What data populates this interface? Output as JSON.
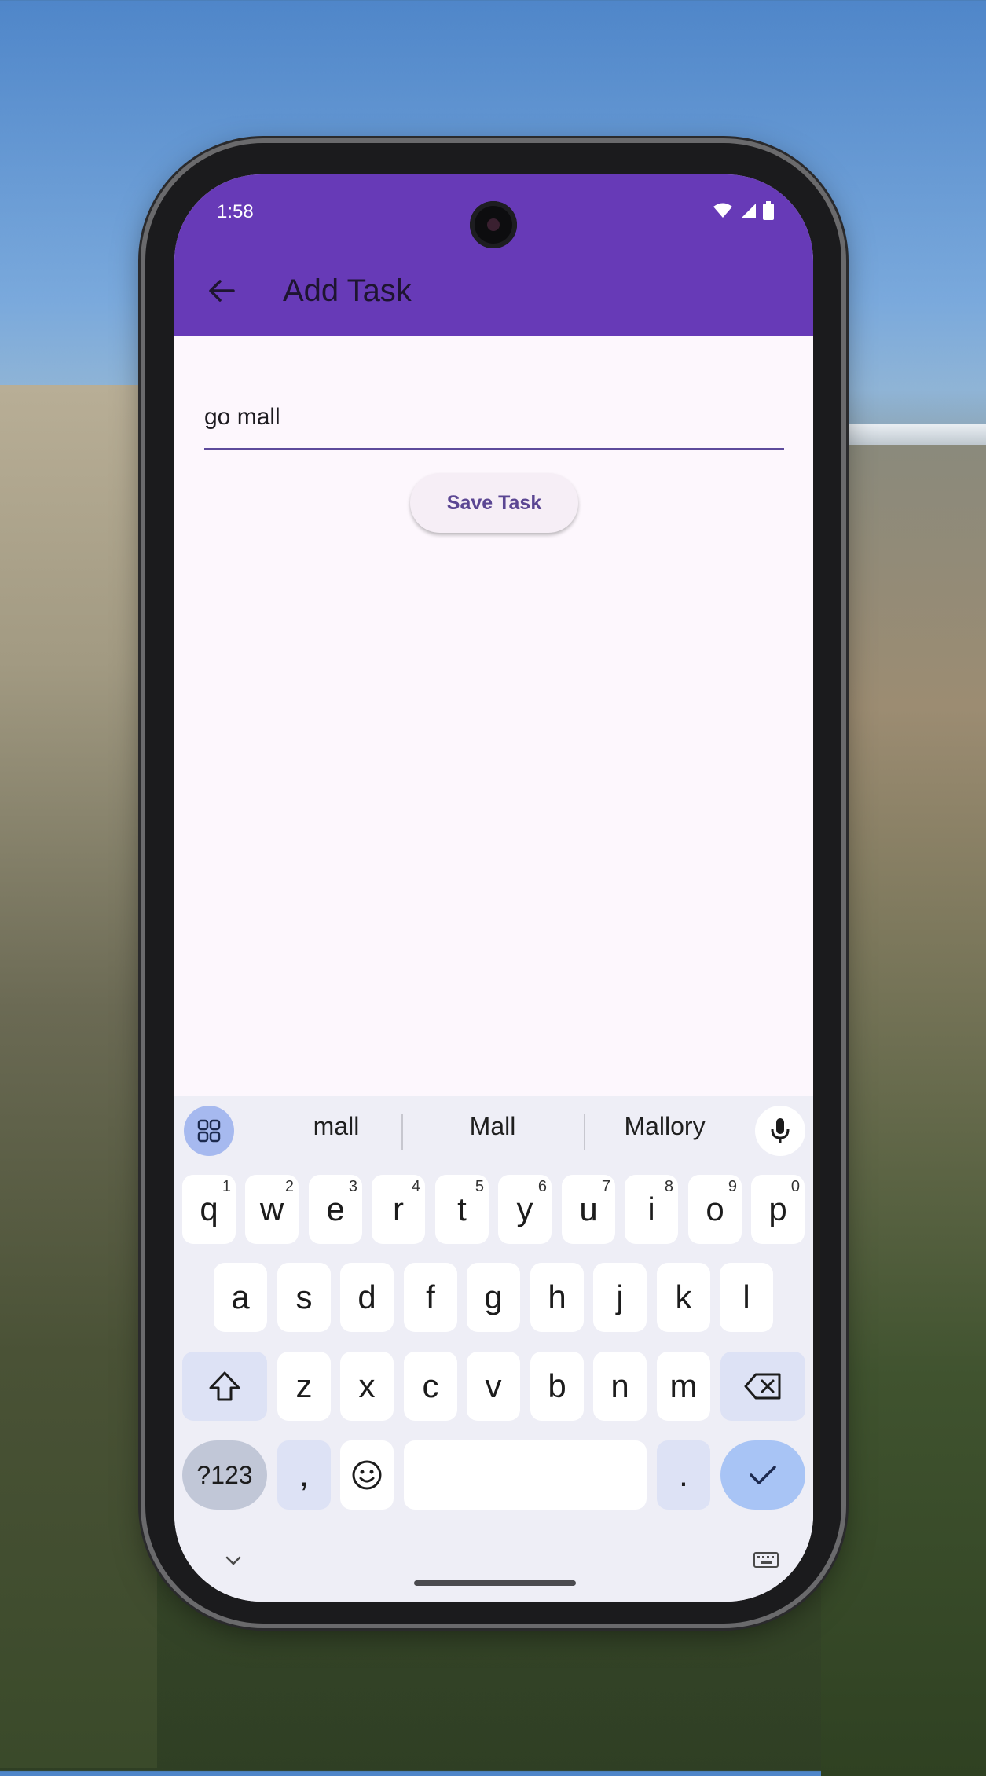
{
  "status_bar": {
    "time": "1:58"
  },
  "app_bar": {
    "title": "Add Task"
  },
  "form": {
    "task_input_value": "go mall",
    "save_button_label": "Save Task"
  },
  "keyboard": {
    "suggestions": [
      "mall",
      "Mall",
      "Mallory"
    ],
    "row1": [
      {
        "label": "q",
        "hint": "1"
      },
      {
        "label": "w",
        "hint": "2"
      },
      {
        "label": "e",
        "hint": "3"
      },
      {
        "label": "r",
        "hint": "4"
      },
      {
        "label": "t",
        "hint": "5"
      },
      {
        "label": "y",
        "hint": "6"
      },
      {
        "label": "u",
        "hint": "7"
      },
      {
        "label": "i",
        "hint": "8"
      },
      {
        "label": "o",
        "hint": "9"
      },
      {
        "label": "p",
        "hint": "0"
      }
    ],
    "row2": [
      "a",
      "s",
      "d",
      "f",
      "g",
      "h",
      "j",
      "k",
      "l"
    ],
    "row3": [
      "z",
      "x",
      "c",
      "v",
      "b",
      "n",
      "m"
    ],
    "row4": {
      "symbols": "?123",
      "comma": ",",
      "period": "."
    }
  },
  "colors": {
    "app_bar": "#673ab7",
    "screen_bg": "#fdf7fd",
    "input_underline": "#5e4b9c",
    "button_text": "#5b4693",
    "enter_key": "#a8c4f5"
  }
}
